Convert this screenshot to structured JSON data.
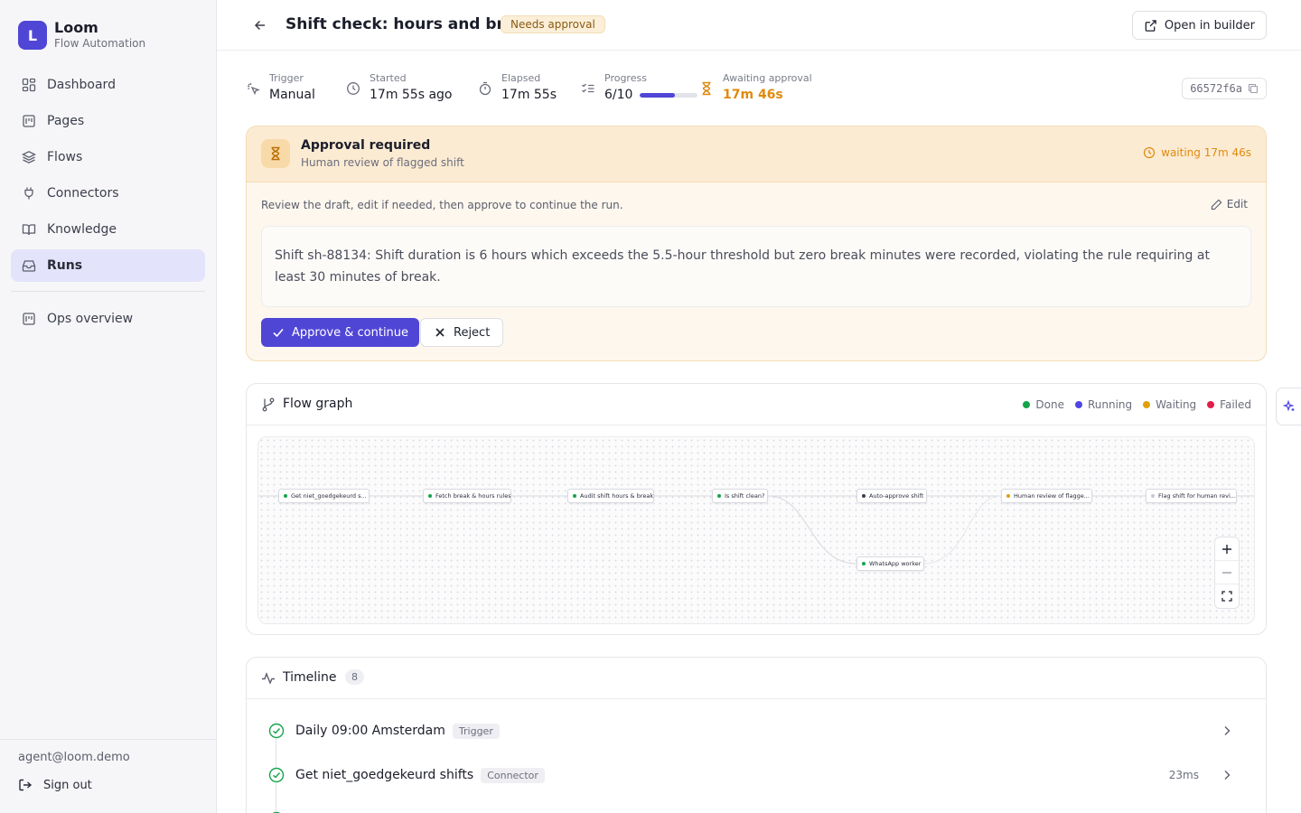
{
  "brand": {
    "logo_letter": "L",
    "name": "Loom",
    "subtitle": "Flow Automation"
  },
  "sidebar": {
    "items": [
      {
        "label": "Dashboard",
        "icon": "dashboard-icon",
        "active": false
      },
      {
        "label": "Pages",
        "icon": "pages-icon",
        "active": false
      },
      {
        "label": "Flows",
        "icon": "layers-icon",
        "active": false
      },
      {
        "label": "Connectors",
        "icon": "plug-icon",
        "active": false
      },
      {
        "label": "Knowledge",
        "icon": "book-icon",
        "active": false
      },
      {
        "label": "Runs",
        "icon": "inbox-icon",
        "active": true
      }
    ],
    "secondary": [
      {
        "label": "Ops overview",
        "icon": "pages-icon"
      }
    ],
    "user_email": "agent@loom.demo",
    "sign_out_label": "Sign out"
  },
  "header": {
    "title": "Shift check: hours and breaks",
    "status": "Needs approval",
    "open_builder_label": "Open in builder"
  },
  "stats": {
    "trigger": {
      "label": "Trigger",
      "value": "Manual"
    },
    "started": {
      "label": "Started",
      "value": "17m 55s ago"
    },
    "elapsed": {
      "label": "Elapsed",
      "value": "17m 55s"
    },
    "progress": {
      "label": "Progress",
      "value": "6/10",
      "fraction": 0.6
    },
    "awaiting": {
      "label": "Awaiting approval",
      "value": "17m 46s"
    },
    "run_id": "66572f6a"
  },
  "approval": {
    "title": "Approval required",
    "subtitle": "Human review of flagged shift",
    "waiting": "waiting 17m 46s",
    "hint": "Review the draft, edit if needed, then approve to continue the run.",
    "edit_label": "Edit",
    "draft": "Shift sh-88134: Shift duration is 6 hours which exceeds the 5.5-hour threshold but zero break minutes were recorded, violating the rule requiring at least 30 minutes of break.",
    "approve_label": "Approve & continue",
    "reject_label": "Reject"
  },
  "flow_graph": {
    "title": "Flow graph",
    "legend": [
      {
        "label": "Done",
        "color": "#16a34a"
      },
      {
        "label": "Running",
        "color": "#4f46e5"
      },
      {
        "label": "Waiting",
        "color": "#e0a00c"
      },
      {
        "label": "Failed",
        "color": "#e11d48"
      }
    ],
    "nodes": [
      {
        "label": "Get niet_goedgekeurd s...",
        "status": "done"
      },
      {
        "label": "Fetch break & hours rules",
        "status": "done"
      },
      {
        "label": "Audit shift hours & break",
        "status": "done"
      },
      {
        "label": "Is shift clean?",
        "status": "done"
      },
      {
        "label": "Auto-approve shift",
        "status": "pending"
      },
      {
        "label": "Human review of flagge...",
        "status": "waiting"
      },
      {
        "label": "Flag shift for human revi...",
        "status": "pending"
      },
      {
        "label": "WhatsApp worker",
        "status": "done"
      }
    ]
  },
  "timeline": {
    "title": "Timeline",
    "count": "8",
    "rows": [
      {
        "name": "Daily 09:00 Amsterdam",
        "tag": "Trigger",
        "duration": ""
      },
      {
        "name": "Get niet_goedgekeurd shifts",
        "tag": "Connector",
        "duration": "23ms"
      }
    ]
  }
}
